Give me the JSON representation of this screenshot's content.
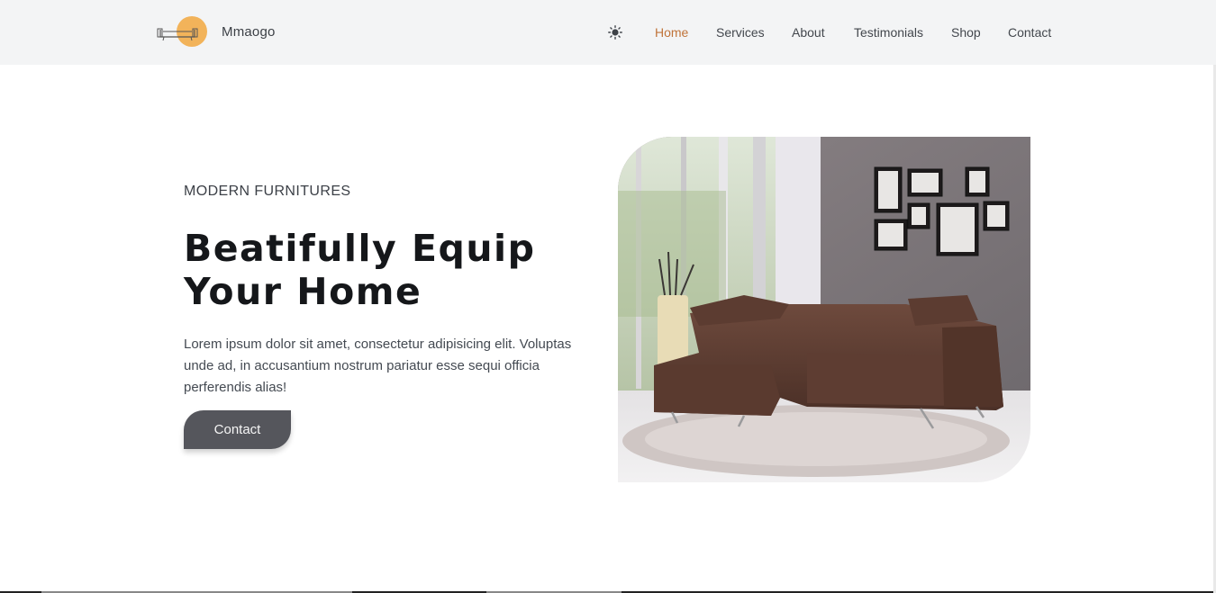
{
  "header": {
    "brand": "Mmaogo",
    "nav": [
      {
        "label": "Home",
        "active": true
      },
      {
        "label": "Services",
        "active": false
      },
      {
        "label": "About",
        "active": false
      },
      {
        "label": "Testimonials",
        "active": false
      },
      {
        "label": "Shop",
        "active": false
      },
      {
        "label": "Contact",
        "active": false
      }
    ],
    "theme_toggle_icon": "sun-icon"
  },
  "hero": {
    "eyebrow": "MODERN FURNITURES",
    "title_line1": "Beatifully Equip",
    "title_line2": "Your Home",
    "description": "Lorem ipsum dolor sit amet, consectetur adipisicing elit. Voluptas unde ad, in accusantium nostrum pariatur esse sequi officia perferendis alias!",
    "cta_label": "Contact",
    "image_subject": "brown leather sectional sofa in living room"
  },
  "colors": {
    "accent": "#c0743a",
    "logo_sun": "#f2b35a",
    "header_bg": "#f3f4f5",
    "button_bg": "#55565c",
    "text_dark": "#15171a"
  }
}
